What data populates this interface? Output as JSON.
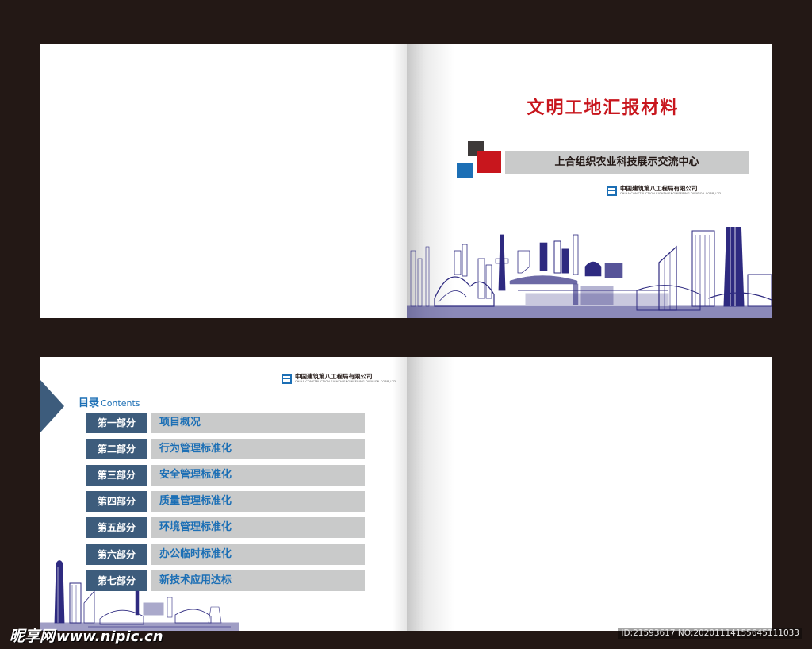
{
  "cover": {
    "title": "文明工地汇报材料",
    "subtitle": "上合组织农业科技展示交流中心",
    "company_cn": "中国建筑第八工程局有限公司",
    "company_en": "CHINA CONSTRUCTION EIGHTH ENGINEERING DIVISION CORP.,LTD"
  },
  "contents": {
    "heading_cn": "目录",
    "heading_en": "Contents",
    "company_cn": "中国建筑第八工程局有限公司",
    "company_en": "CHINA CONSTRUCTION EIGHTH ENGINEERING DIVISION CORP.,LTD",
    "items": [
      {
        "part": "第一部分",
        "title": "项目概况"
      },
      {
        "part": "第二部分",
        "title": "行为管理标准化"
      },
      {
        "part": "第三部分",
        "title": "安全管理标准化"
      },
      {
        "part": "第四部分",
        "title": "质量管理标准化"
      },
      {
        "part": "第五部分",
        "title": "环境管理标准化"
      },
      {
        "part": "第六部分",
        "title": "办公临时标准化"
      },
      {
        "part": "第七部分",
        "title": "新技术应用达标"
      }
    ]
  },
  "colors": {
    "background": "#231815",
    "title_red": "#c8161d",
    "accent_blue": "#1c6fb5",
    "navy": "#3d5c7c",
    "bar_gray": "#c9caca",
    "skyline": "#2e2a80"
  },
  "watermark": {
    "brand": "昵享网",
    "site": "www.nipic.cn",
    "id": "ID:21593617 NO:20201114155645111033"
  }
}
